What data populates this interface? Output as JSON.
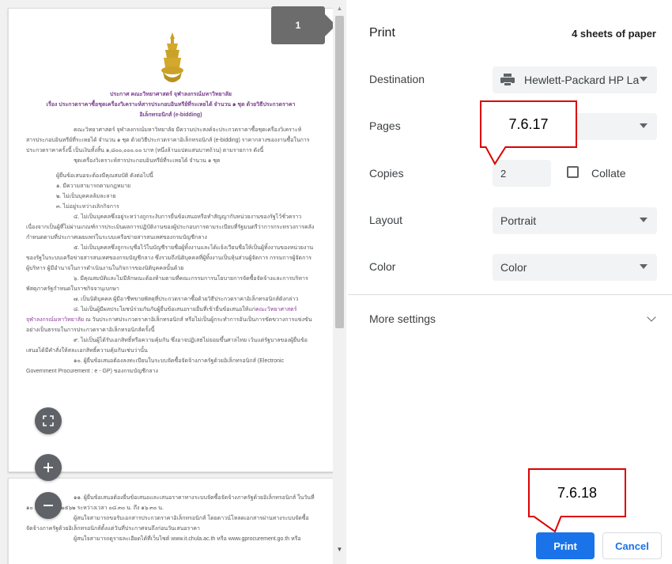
{
  "preview": {
    "page_number": "1",
    "doc_title_1": "ประกาศ คณะวิทยาศาสตร์ จุฬาลงกรณ์มหาวิทยาลัย",
    "doc_title_2": "เรื่อง ประกวดราคาซื้อชุดเครื่องวิเคราะห์สารประกอบอินทรีย์ที่ระเหยได้ จำนวน ๑ ชุด ด้วยวิธีประกวดราคา",
    "doc_title_3": "อิเล็กทรอนิกส์ (e-bidding)",
    "para_1": "คณะวิทยาศาสตร์ จุฬาลงกรณ์มหาวิทยาลัย มีความประสงค์จะประกวดราคาซื้อชุดเครื่องวิเคราะห์สารประกอบอินทรีย์ที่ระเหยได้ จำนวน ๑ ชุด ด้วยวิธีประกวดราคาอิเล็กทรอนิกส์ (e-bidding) ราคากลางของงานซื้อในการประกวดราคาครั้งนี้ เป็นเงินทั้งสิ้น ๑,๘๐๐,๐๐๐.๐๐ บาท (หนึ่งล้านแปดแสนบาทถ้วน) ตามรายการ ดังนี้",
    "para_2": "ชุดเครื่องวิเคราะห์สารประกอบอินทรีย์ที่ระเหยได้ จำนวน ๑ ชุด",
    "para_3": "ผู้ยื่นข้อเสนอจะต้องมีคุณสมบัติ ดังต่อไปนี้",
    "item_1": "๑. มีความสามารถตามกฎหมาย",
    "item_2": "๒. ไม่เป็นบุคคลล้มละลาย",
    "item_3": "๓. ไม่อยู่ระหว่างเลิกกิจการ",
    "para_4": "๔. ไม่เป็นบุคคลซึ่งอยู่ระหว่างถูกระงับการยื่นข้อเสนอหรือทำสัญญากับหน่วยงานของรัฐไว้ชั่วคราวเนื่องจากเป็นผู้ที่ไม่ผ่านเกณฑ์การประเมินผลการปฏิบัติงานของผู้ประกอบการตามระเบียบที่รัฐมนตรีว่าการกระทรวงการคลังกำหนดตามที่ประกาศเผยแพร่ในระบบเครือข่ายสารสนเทศของกรมบัญชีกลาง",
    "para_5": "๕. ไม่เป็นบุคคลซึ่งถูกระบุชื่อไว้ในบัญชีรายชื่อผู้ทิ้งงานและได้แจ้งเวียนชื่อให้เป็นผู้ทิ้งงานของหน่วยงานของรัฐในระบบเครือข่ายสารสนเทศของกรมบัญชีกลาง ซึ่งรวมถึงนิติบุคคลที่ผู้ทิ้งงานเป็นหุ้นส่วนผู้จัดการ กรรมการผู้จัดการ ผู้บริหาร ผู้มีอำนาจในการดำเนินงานในกิจการของนิติบุคคลนั้นด้วย",
    "para_6": "๖. มีคุณสมบัติและไม่มีลักษณะต้องห้ามตามที่คณะกรรมการนโยบายการจัดซื้อจัดจ้างและการบริหารพัสดุภาครัฐกำหนดในราชกิจจานุเบกษา",
    "para_7": "๗. เป็นนิติบุคคล ผู้มีอาชีพขายพัสดุที่ประกวดราคาซื้อด้วยวิธีประกวดราคาอิเล็กทรอนิกส์ดังกล่าว",
    "para_8a": "๘. ไม่เป็นผู้มีผลประโยชน์ร่วมกันกับผู้ยื่นข้อเสนอรายอื่นที่เข้ายื่นข้อเสนอให้แก่",
    "para_8b": "คณะวิทยาศาสตร์ จุฬาลงกรณ์มหาวิทยาลัย",
    "para_8c": "ณ วันประกาศประกวดราคาอิเล็กทรอนิกส์ หรือไม่เป็นผู้กระทำการอันเป็นการขัดขวางการแข่งขันอย่างเป็นธรรมในการประกวดราคาอิเล็กทรอนิกส์ครั้งนี้",
    "para_9": "๙. ไม่เป็นผู้ได้รับเอกสิทธิ์หรือความคุ้มกัน ซึ่งอาจปฏิเสธไม่ยอมขึ้นศาลไทย เว้นแต่รัฐบาลของผู้ยื่นข้อเสนอได้มีคำสั่งให้สละเอกสิทธิ์ความคุ้มกันเช่นว่านั้น",
    "para_10": "๑๐. ผู้ยื่นข้อเสนอต้องลงทะเบียนในระบบจัดซื้อจัดจ้างภาครัฐด้วยอิเล็กทรอนิกส์ (Electronic Government Procurement : e - GP) ของกรมบัญชีกลาง",
    "page2_1": "๑๑. ผู้ยื่นข้อเสนอต้องยื่นข้อเสนอและเสนอราคาทางระบบจัดซื้อจัดจ้างภาครัฐด้วยอิเล็กทรอนิกส์ ในวันที่ ๑๐ กุมภาพันธ์ ๒๕๖๒ ระหว่างเวลา ๐๘.๓๐ น. ถึง ๑๖.๓๐ น.",
    "page2_2": "ผู้สนใจสามารถขอรับเอกสารประกวดราคาอิเล็กทรอนิกส์ โดยดาวน์โหลดเอกสารผ่านทางระบบจัดซื้อจัดจ้างภาครัฐด้วยอิเล็กทรอนิกส์ตั้งแต่วันที่ประกาศจนถึงก่อนวันเสนอราคา",
    "page2_3": "ผู้สนใจสามารถดูรายละเอียดได้ที่เว็บไซต์ www.it.chula.ac.th หรือ www.gprocurement.go.th หรือ"
  },
  "settings": {
    "title": "Print",
    "sheets": "4 sheets of paper",
    "destination_label": "Destination",
    "destination_value": "Hewlett-Packard HP La",
    "pages_label": "Pages",
    "pages_value": "",
    "copies_label": "Copies",
    "copies_value": "2",
    "collate_label": "Collate",
    "collate_checked": false,
    "layout_label": "Layout",
    "layout_value": "Portrait",
    "color_label": "Color",
    "color_value": "Color",
    "more_settings": "More settings",
    "print_label": "Print",
    "cancel_label": "Cancel"
  },
  "annotations": {
    "callout_1": "7.6.17",
    "callout_2": "7.6.18",
    "border_color": "#dd0000"
  },
  "colors": {
    "accent": "#1a73e8",
    "badge": "#6c6c6c",
    "field_bg": "#f1f3f4"
  }
}
